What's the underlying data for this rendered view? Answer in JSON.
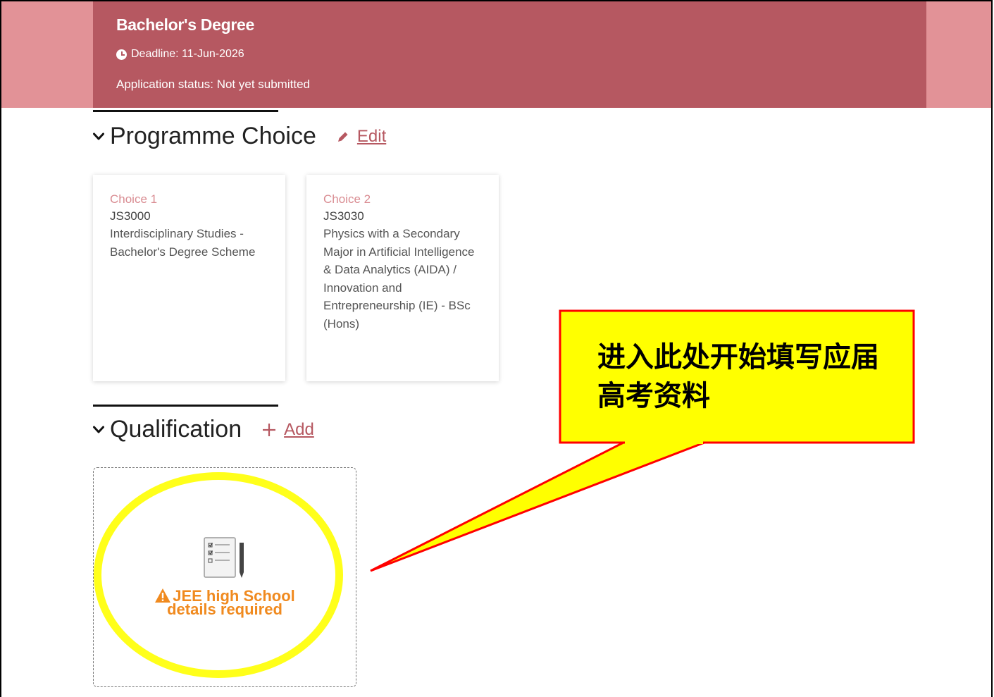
{
  "header": {
    "degree_title": "Bachelor's Degree",
    "deadline": "Deadline: 11-Jun-2026",
    "application_status": "Application status: Not yet submitted"
  },
  "programme_choice": {
    "title": "Programme Choice",
    "edit_label": "Edit",
    "choices": [
      {
        "label": "Choice 1",
        "code": "JS3000",
        "name": "Interdisciplinary Studies - Bachelor's Degree Scheme"
      },
      {
        "label": "Choice 2",
        "code": "JS3030",
        "name": "Physics with a Secondary Major in Artificial Intelligence & Data Analytics (AIDA) / Innovation and Entrepreneurship (IE) - BSc (Hons)"
      }
    ]
  },
  "qualification": {
    "title": "Qualification",
    "add_label": "Add",
    "card": {
      "warning_line1": "JEE high School",
      "warning_line2": "details required"
    }
  },
  "annotation": {
    "callout_text": "进入此处开始填写应届高考资料",
    "callout_fill": "#ffff00",
    "callout_border": "#ff0000",
    "highlight_color": "#ffff1a"
  },
  "colors": {
    "accent": "#b65861",
    "band_outer": "#e29297",
    "choice_label": "#d98c92",
    "warning": "#f08a1f"
  },
  "icons": [
    "clock-icon",
    "chevron-down-icon",
    "pencil-icon",
    "plus-icon",
    "form-icon",
    "warning-icon"
  ]
}
